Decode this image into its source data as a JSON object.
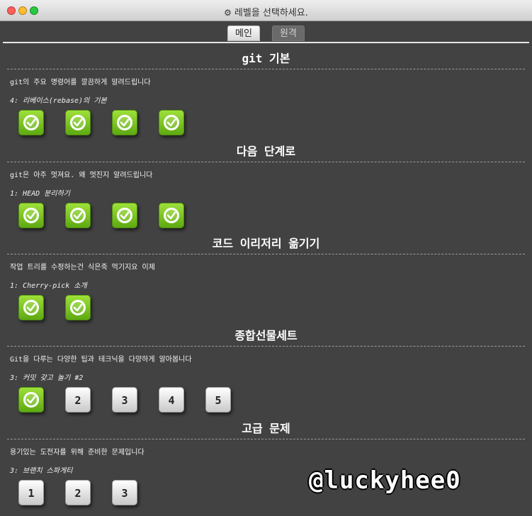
{
  "window": {
    "title": "레벨을 선택하세요.",
    "title_icon": "gear-icon"
  },
  "tabs": [
    {
      "label": "메인",
      "active": true
    },
    {
      "label": "원격",
      "active": false
    }
  ],
  "sections": [
    {
      "title": "git 기본",
      "description": "git의 주요 명령어를 깔끔하게 알려드립니다",
      "progress": "4: 리베이스(rebase)의 기본",
      "levels": [
        {
          "label": "",
          "done": true
        },
        {
          "label": "",
          "done": true
        },
        {
          "label": "",
          "done": true
        },
        {
          "label": "",
          "done": true
        }
      ]
    },
    {
      "title": "다음 단계로",
      "description": "git은 아주 멋져요. 왜 멋진지 알려드립니다",
      "progress": "1: HEAD 분리하기",
      "levels": [
        {
          "label": "",
          "done": true
        },
        {
          "label": "",
          "done": true
        },
        {
          "label": "",
          "done": true
        },
        {
          "label": "",
          "done": true
        }
      ]
    },
    {
      "title": "코드 이리저리 옮기기",
      "description": "작업 트리를 수정하는건 식은죽 먹기지요 이제",
      "progress": "1: Cherry-pick 소개",
      "levels": [
        {
          "label": "",
          "done": true
        },
        {
          "label": "",
          "done": true
        }
      ]
    },
    {
      "title": "종합선물세트",
      "description": "Git을 다루는 다양한 팁과 테크닉을 다양하게 알아봅니다",
      "progress": "3: 커밋 갖고 놀기 #2",
      "levels": [
        {
          "label": "",
          "done": true
        },
        {
          "label": "2",
          "done": false
        },
        {
          "label": "3",
          "done": false
        },
        {
          "label": "4",
          "done": false
        },
        {
          "label": "5",
          "done": false
        }
      ]
    },
    {
      "title": "고급 문제",
      "description": "용기있는 도전자를 위해 준비한 문제입니다",
      "progress": "3: 브랜치 스파게티",
      "levels": [
        {
          "label": "1",
          "done": false
        },
        {
          "label": "2",
          "done": false
        },
        {
          "label": "3",
          "done": false
        }
      ]
    }
  ],
  "watermark": "@luckyhee0",
  "colors": {
    "background": "#424242",
    "level_done": "#7cc424",
    "level_todo": "#e6e6e6"
  }
}
